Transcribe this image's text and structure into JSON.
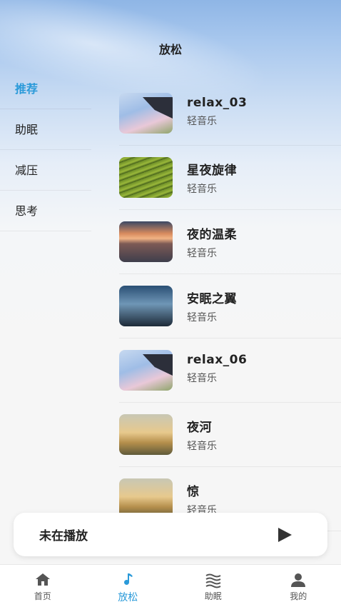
{
  "header": {
    "title": "放松"
  },
  "sidebar": {
    "items": [
      {
        "label": "推荐",
        "active": true
      },
      {
        "label": "助眠",
        "active": false
      },
      {
        "label": "减压",
        "active": false
      },
      {
        "label": "思考",
        "active": false
      }
    ]
  },
  "tracks": [
    {
      "title": "relax_03",
      "genre": "轻音乐",
      "thumb": "temple"
    },
    {
      "title": "星夜旋律",
      "genre": "轻音乐",
      "thumb": "terrace"
    },
    {
      "title": "夜的温柔",
      "genre": "轻音乐",
      "thumb": "sunset"
    },
    {
      "title": "安眠之翼",
      "genre": "轻音乐",
      "thumb": "night"
    },
    {
      "title": "relax_06",
      "genre": "轻音乐",
      "thumb": "temple"
    },
    {
      "title": "夜河",
      "genre": "轻音乐",
      "thumb": "evening"
    },
    {
      "title": "惊",
      "genre": "轻音乐",
      "thumb": "evening"
    }
  ],
  "player": {
    "status": "未在播放",
    "play_icon": "play-icon"
  },
  "tabbar": {
    "tabs": [
      {
        "label": "首页",
        "icon": "home-icon"
      },
      {
        "label": "放松",
        "icon": "music-note-icon",
        "active": true
      },
      {
        "label": "助眠",
        "icon": "waves-icon"
      },
      {
        "label": "我的",
        "icon": "person-icon"
      }
    ]
  },
  "colors": {
    "accent": "#2a9ad9",
    "text": "#222222",
    "icon_gray": "#555555"
  }
}
